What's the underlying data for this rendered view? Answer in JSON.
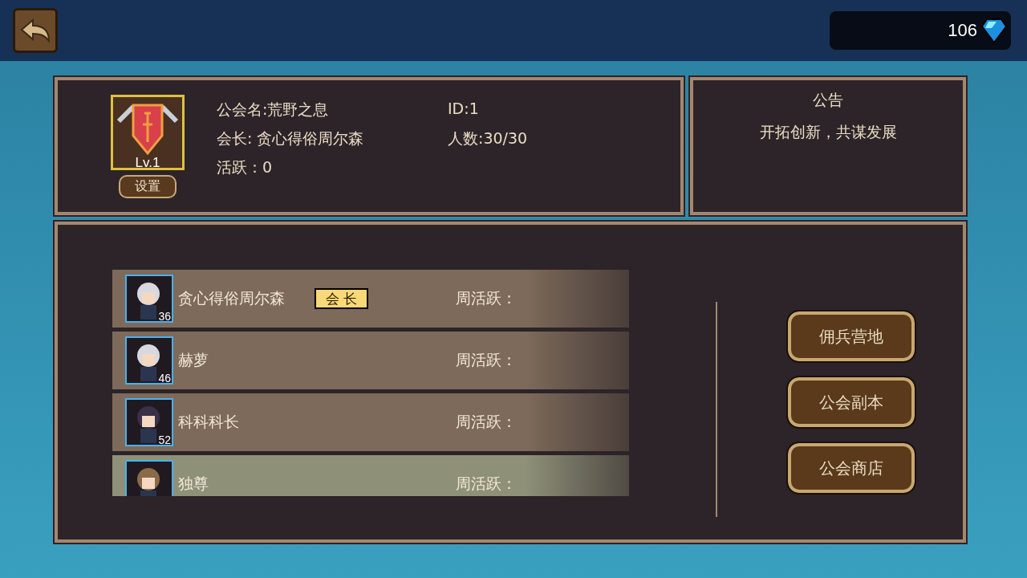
{
  "currency": {
    "amount": "106"
  },
  "guild": {
    "level": "Lv.1",
    "settings_button": "设置",
    "name": "公会名:荒野之息",
    "id": "ID:1",
    "leader": "会长: 贪心得俗周尔森",
    "members_count": "人数:30/30",
    "activity": "活跃：0"
  },
  "notice": {
    "title": "公告",
    "text": "开拓创新，共谋发展"
  },
  "members": [
    {
      "name": "贪心得俗周尔森",
      "level": "36",
      "badge": "会 长",
      "weekly_label": "周活跃：",
      "kind": "silver",
      "selected": false
    },
    {
      "name": "赫萝",
      "level": "46",
      "weekly_label": "周活跃：",
      "kind": "silver",
      "selected": false
    },
    {
      "name": "科科科长",
      "level": "52",
      "weekly_label": "周活跃：",
      "kind": "dark",
      "selected": false
    },
    {
      "name": "独尊",
      "weekly_label": "周活跃：",
      "kind": "hat",
      "selected": true
    }
  ],
  "actions": [
    "佣兵营地",
    "公会副本",
    "公会商店"
  ]
}
